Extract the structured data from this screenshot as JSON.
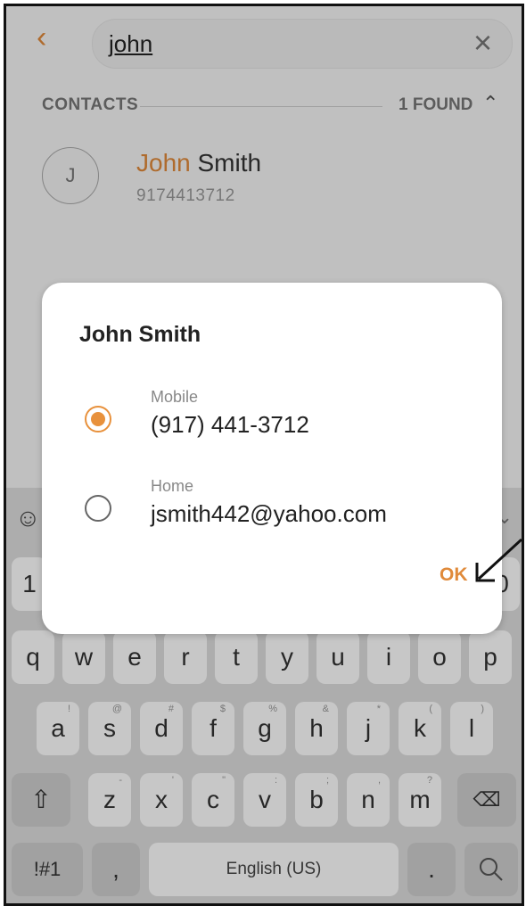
{
  "search": {
    "back_icon": "chevron-left-icon",
    "query": "john",
    "clear_icon": "close-icon"
  },
  "section": {
    "title": "CONTACTS",
    "found": "1 FOUND",
    "collapse_icon": "chevron-up-icon"
  },
  "contact": {
    "initial": "J",
    "name_match": "John",
    "name_rest": " Smith",
    "phone": "9174413712"
  },
  "dialog": {
    "title": "John Smith",
    "options": [
      {
        "type": "Mobile",
        "value": "(917) 441-3712",
        "selected": true
      },
      {
        "type": "Home",
        "value": "jsmith442@yahoo.com",
        "selected": false
      }
    ],
    "ok_label": "OK"
  },
  "keyboard": {
    "number_row": [
      "1",
      "0"
    ],
    "row1": [
      {
        "k": "q",
        "s": ""
      },
      {
        "k": "w",
        "s": ""
      },
      {
        "k": "e",
        "s": ""
      },
      {
        "k": "r",
        "s": ""
      },
      {
        "k": "t",
        "s": ""
      },
      {
        "k": "y",
        "s": ""
      },
      {
        "k": "u",
        "s": ""
      },
      {
        "k": "i",
        "s": ""
      },
      {
        "k": "o",
        "s": ""
      },
      {
        "k": "p",
        "s": ""
      }
    ],
    "row2": [
      {
        "k": "a",
        "s": "!"
      },
      {
        "k": "s",
        "s": "@"
      },
      {
        "k": "d",
        "s": "#"
      },
      {
        "k": "f",
        "s": "$"
      },
      {
        "k": "g",
        "s": "%"
      },
      {
        "k": "h",
        "s": "&"
      },
      {
        "k": "j",
        "s": "*"
      },
      {
        "k": "k",
        "s": "("
      },
      {
        "k": "l",
        "s": ")"
      }
    ],
    "row3": [
      {
        "k": "z",
        "s": "-"
      },
      {
        "k": "x",
        "s": "'"
      },
      {
        "k": "c",
        "s": "\""
      },
      {
        "k": "v",
        "s": ":"
      },
      {
        "k": "b",
        "s": ";"
      },
      {
        "k": "n",
        "s": ","
      },
      {
        "k": "m",
        "s": "?"
      }
    ],
    "symbols_label": "!#1",
    "comma_label": ",",
    "space_label": "English (US)",
    "period_label": ".",
    "shift_icon": "shift-icon",
    "backspace_icon": "backspace-icon",
    "search_icon": "search-icon",
    "emoji_icon": "emoji-icon",
    "hide_icon": "chevron-down-icon"
  },
  "colors": {
    "accent": "#e08a3a",
    "radio_selected": "#e8913c"
  }
}
